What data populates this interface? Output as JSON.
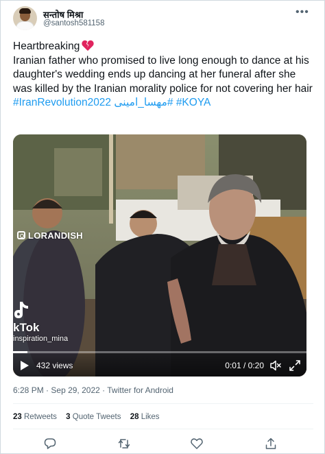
{
  "author": {
    "display_name": "सन्तोष मिश्रा",
    "username": "@santosh581158"
  },
  "tweet": {
    "line1": "Heartbreaking",
    "line1_emoji": "broken-heart-icon",
    "body": "Iranian father who promised to live long enough to dance at his daughter's wedding ends up dancing at her funeral after she was killed by the Iranian morality police for not covering her hair",
    "hashtag_1": "#IranRevolution2022",
    "hashtag_2": "#مهسا_امینی",
    "hashtag_3": "#KOYA"
  },
  "video": {
    "watermark": "LORANDISH",
    "tiktok_label": "kTok",
    "tiktok_user": "inspiration_mina",
    "views": "432 views",
    "time": "0:01 / 0:20",
    "progress": 0.05,
    "icons": [
      "play-icon",
      "mute-icon",
      "fullscreen-icon"
    ]
  },
  "meta": {
    "time": "6:28 PM",
    "separator": "·",
    "date": "Sep 29, 2022",
    "source": "Twitter for Android"
  },
  "stats": {
    "retweets_count": "23",
    "retweets_label": "Retweets",
    "quotes_count": "3",
    "quotes_label": "Quote Tweets",
    "likes_count": "28",
    "likes_label": "Likes"
  },
  "colors": {
    "link": "#1d9bf0",
    "text": "#0f1419",
    "muted": "#536471",
    "heart": "#e0245e"
  }
}
